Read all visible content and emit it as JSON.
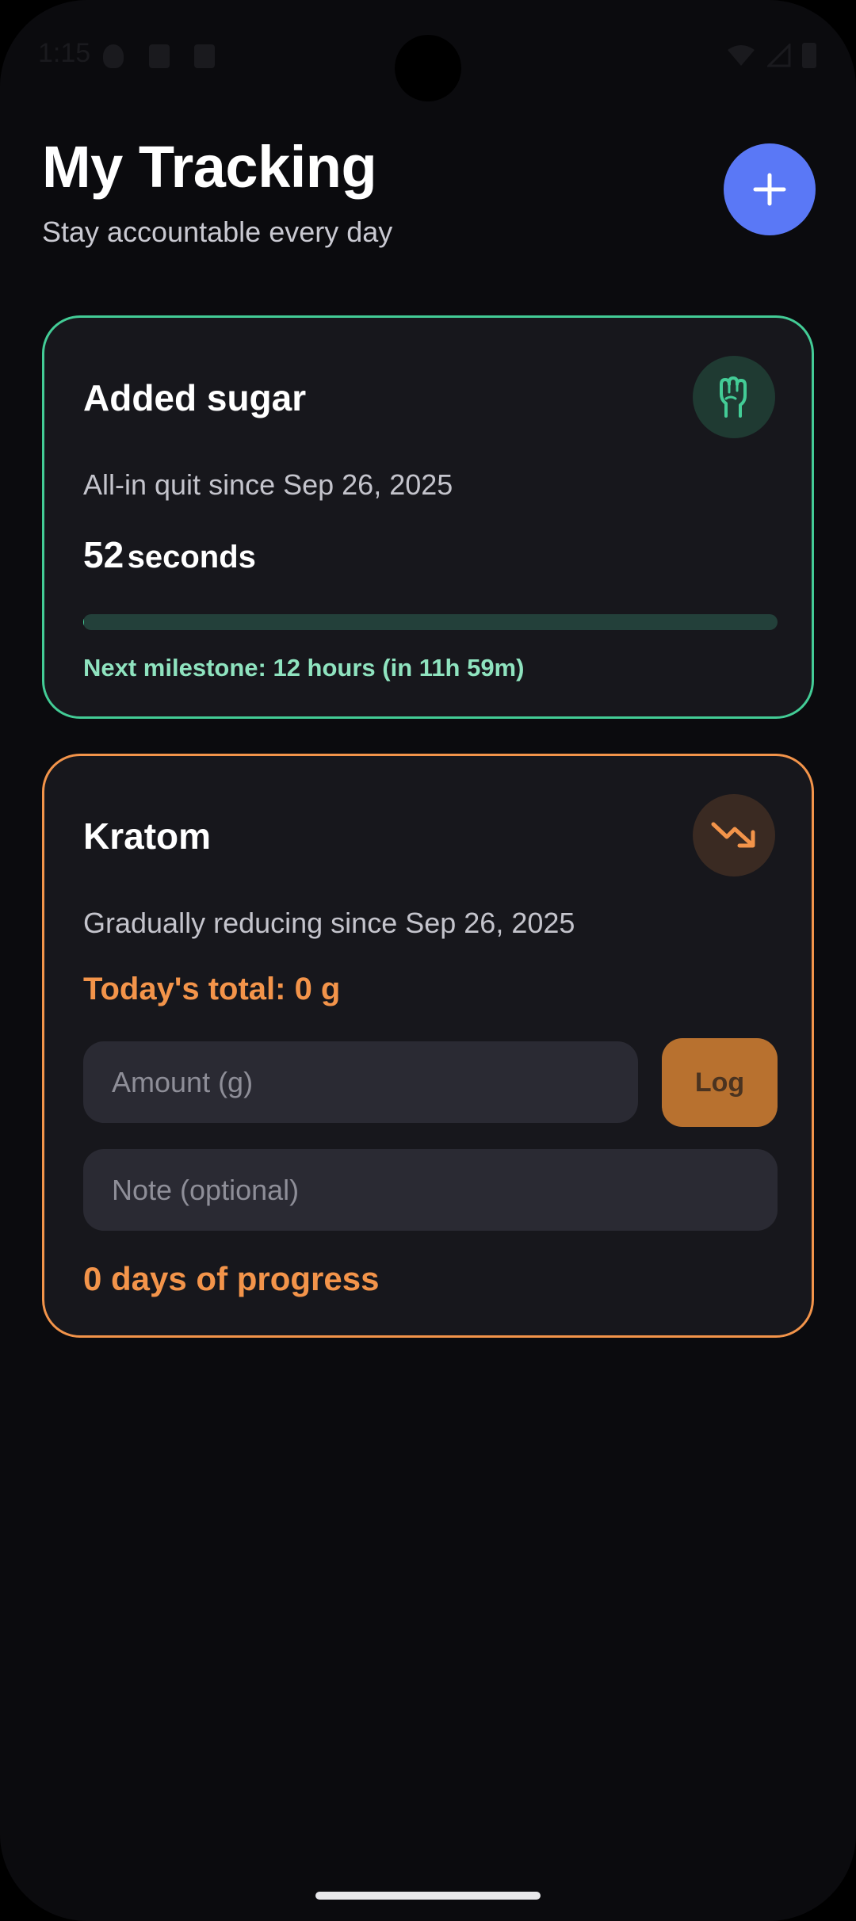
{
  "status_bar": {
    "time": "1:15",
    "icons": [
      "shield-icon",
      "a-icon",
      "sd-card-icon",
      "wifi-icon",
      "signal-icon",
      "battery-icon"
    ]
  },
  "header": {
    "title": "My Tracking",
    "subtitle": "Stay accountable every day",
    "add_icon": "plus-icon"
  },
  "cards": [
    {
      "title": "Added sugar",
      "icon": "fist-icon",
      "meta": "All-in quit since Sep 26, 2025",
      "elapsed_value": "52",
      "elapsed_unit": "seconds",
      "progress_fraction": 0.001,
      "milestone": "Next milestone: 12 hours (in 11h 59m)"
    },
    {
      "title": "Kratom",
      "icon": "trending-down-icon",
      "meta": "Gradually reducing since Sep 26, 2025",
      "today_total": "Today's total: 0 g",
      "amount_placeholder": "Amount (g)",
      "note_placeholder": "Note (optional)",
      "log_label": "Log",
      "progress_days": "0 days of progress"
    }
  ],
  "colors": {
    "background": "#0b0b0e",
    "card_background": "#17171c",
    "accent_blue": "#5a78f6",
    "quit_green": "#43cc96",
    "reduce_orange": "#f3944a"
  }
}
